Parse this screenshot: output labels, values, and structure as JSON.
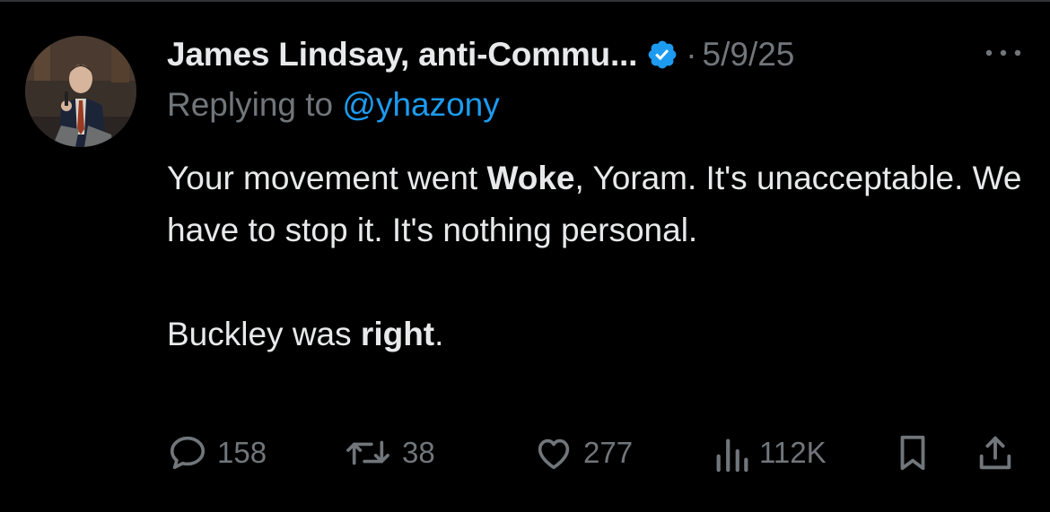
{
  "colors": {
    "background": "#000000",
    "text_primary": "#e7e9ea",
    "text_secondary": "#71767b",
    "accent_blue": "#1d9bf0"
  },
  "post": {
    "author_name": "James Lindsay, anti-Commu...",
    "verified_icon": "verified-badge-icon",
    "separator": "·",
    "date": "5/9/25",
    "more_icon": "more-horizontal-icon",
    "reply": {
      "prefix": "Replying to",
      "handle": "@yhazony"
    },
    "body": {
      "p1_before": "Your movement went ",
      "p1_bold": "Woke",
      "p1_after": ", Yoram. It's unacceptable. We have to stop it. It's nothing personal.",
      "p2_before": "Buckley was ",
      "p2_bold": "right",
      "p2_after": "."
    },
    "actions": {
      "replies": {
        "icon": "reply-icon",
        "count": "158"
      },
      "reposts": {
        "icon": "repost-icon",
        "count": "38"
      },
      "likes": {
        "icon": "like-icon",
        "count": "277"
      },
      "views": {
        "icon": "views-icon",
        "count": "112K"
      },
      "bookmark": {
        "icon": "bookmark-icon"
      },
      "share": {
        "icon": "share-icon"
      }
    }
  }
}
